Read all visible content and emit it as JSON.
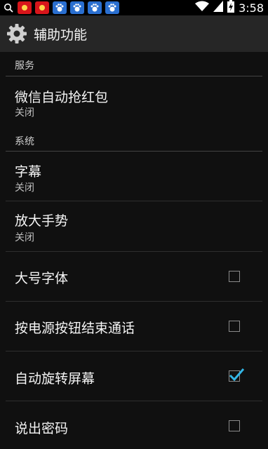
{
  "status_bar": {
    "icons": [
      "search-icon",
      "red-envelope-icon",
      "red-envelope-icon",
      "baidu-icon",
      "baidu-icon",
      "baidu-icon",
      "baidu-icon"
    ],
    "time": "3:58"
  },
  "header": {
    "title": "辅助功能"
  },
  "sections": {
    "services": "服务",
    "system": "系统"
  },
  "items": {
    "wechat": {
      "title": "微信自动抢红包",
      "summary": "关闭"
    },
    "captions": {
      "title": "字幕",
      "summary": "关闭"
    },
    "magnify": {
      "title": "放大手势",
      "summary": "关闭"
    },
    "large_text": {
      "title": "大号字体",
      "checked": false
    },
    "power_end_call": {
      "title": "按电源按钮结束通话",
      "checked": false
    },
    "auto_rotate": {
      "title": "自动旋转屏幕",
      "checked": true
    },
    "speak_passwords": {
      "title": "说出密码",
      "checked": false
    }
  },
  "colors": {
    "accent": "#33b5e5",
    "background": "#101010",
    "actionbar": "#262626"
  }
}
